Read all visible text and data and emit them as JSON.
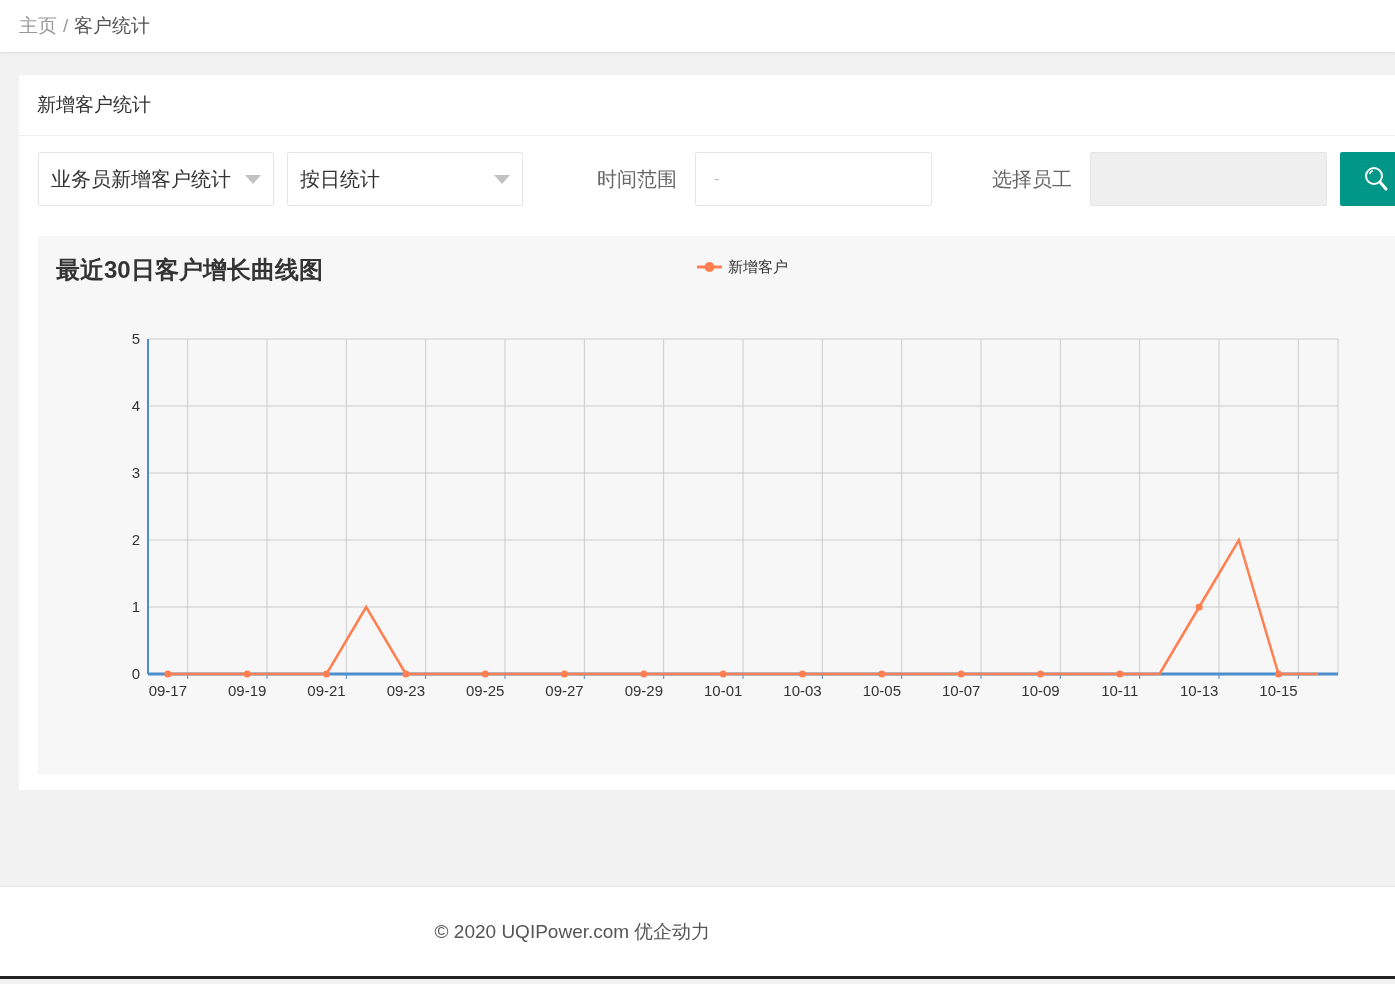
{
  "breadcrumb": {
    "separator": "/",
    "items": [
      {
        "label": "主页",
        "current": false
      },
      {
        "label": "客户统计",
        "current": true
      }
    ]
  },
  "card": {
    "title": "新增客户统计"
  },
  "filters": {
    "type_select": {
      "value": "业务员新增客户统计"
    },
    "period_select": {
      "value": "按日统计"
    },
    "time_range": {
      "label": "时间范围",
      "placeholder": "-"
    },
    "employee": {
      "label": "选择员工",
      "disabled": true
    }
  },
  "chart": {
    "title": "最近30日客户增长曲线图",
    "chart_data": {
      "type": "line",
      "grid": true,
      "categories": [
        "09-17",
        null,
        "09-19",
        null,
        "09-21",
        null,
        "09-23",
        null,
        "09-25",
        null,
        "09-27",
        null,
        "09-29",
        null,
        "10-01",
        null,
        "10-03",
        null,
        "10-05",
        null,
        "10-07",
        null,
        "10-09",
        null,
        "10-11",
        null,
        "10-13",
        null,
        "10-15",
        null
      ],
      "ylim": [
        0,
        5
      ],
      "yticks": [
        0,
        1,
        2,
        3,
        4,
        5
      ],
      "series": [
        {
          "name": "新增客户",
          "color": "#ff7f50",
          "values": [
            0,
            0,
            0,
            0,
            0,
            1,
            0,
            0,
            0,
            0,
            0,
            0,
            0,
            0,
            0,
            0,
            0,
            0,
            0,
            0,
            0,
            0,
            0,
            0,
            0,
            0,
            1,
            2,
            0,
            0
          ]
        }
      ]
    }
  },
  "footer": {
    "text": "© 2020 UQIPower.com 优企动力"
  }
}
